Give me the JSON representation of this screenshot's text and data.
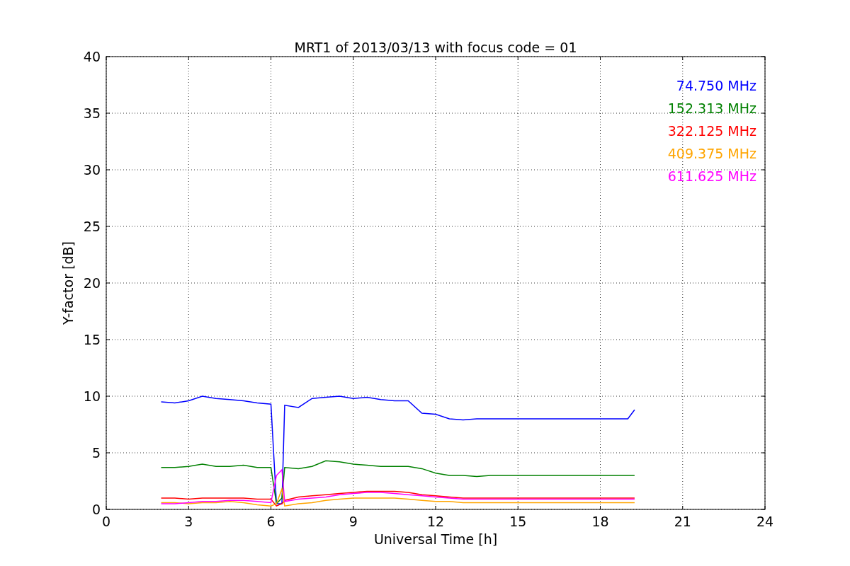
{
  "chart_data": {
    "type": "line",
    "title": "MRT1 of 2013/03/13 with focus code = 01",
    "xlabel": "Universal Time [h]",
    "ylabel": "Y-factor [dB]",
    "x": [
      2,
      2.5,
      3,
      3.5,
      4,
      4.5,
      5,
      5.5,
      6,
      6.2,
      6.4,
      6.5,
      7,
      7.5,
      8,
      8.5,
      9,
      9.5,
      10,
      10.5,
      11,
      11.5,
      12,
      12.5,
      13,
      13.5,
      14,
      19,
      19.25
    ],
    "series": [
      {
        "name": "74.750 MHz",
        "color": "#0000ff",
        "values": [
          9.5,
          9.4,
          9.6,
          10,
          9.8,
          9.7,
          9.6,
          9.4,
          9.3,
          0.5,
          0.5,
          9.2,
          9.0,
          9.8,
          9.9,
          10,
          9.8,
          9.9,
          9.7,
          9.6,
          9.6,
          8.5,
          8.4,
          8.0,
          7.9,
          8.0,
          8.0,
          8.0,
          8.8
        ]
      },
      {
        "name": "152.313 MHz",
        "color": "#008000",
        "values": [
          3.7,
          3.7,
          3.8,
          4.0,
          3.8,
          3.8,
          3.9,
          3.7,
          3.7,
          0.5,
          1.0,
          3.7,
          3.6,
          3.8,
          4.3,
          4.2,
          4.0,
          3.9,
          3.8,
          3.8,
          3.8,
          3.6,
          3.2,
          3.0,
          3.0,
          2.9,
          3.0,
          3.0,
          3.0
        ]
      },
      {
        "name": "322.125 MHz",
        "color": "#ff0000",
        "values": [
          1.0,
          1.0,
          0.9,
          1.0,
          1.0,
          1.0,
          1.0,
          0.9,
          0.9,
          0.3,
          0.5,
          0.8,
          1.1,
          1.2,
          1.3,
          1.4,
          1.5,
          1.6,
          1.6,
          1.6,
          1.5,
          1.3,
          1.2,
          1.1,
          1.0,
          1.0,
          1.0,
          1.0,
          1.0
        ]
      },
      {
        "name": "409.375 MHz",
        "color": "#ffa500",
        "values": [
          0.6,
          0.6,
          0.5,
          0.6,
          0.6,
          0.7,
          0.6,
          0.4,
          0.3,
          0.5,
          1.8,
          0.3,
          0.5,
          0.6,
          0.8,
          0.9,
          1.0,
          1.0,
          1.0,
          1.0,
          0.9,
          0.8,
          0.7,
          0.7,
          0.6,
          0.6,
          0.6,
          0.6,
          0.6
        ]
      },
      {
        "name": "611.625 MHz",
        "color": "#ff00ff",
        "values": [
          0.5,
          0.5,
          0.6,
          0.7,
          0.7,
          0.8,
          0.8,
          0.7,
          0.6,
          3.0,
          3.5,
          0.7,
          0.9,
          1.0,
          1.1,
          1.3,
          1.4,
          1.5,
          1.5,
          1.4,
          1.3,
          1.2,
          1.1,
          1.0,
          0.9,
          0.9,
          0.9,
          0.9,
          0.9
        ]
      }
    ],
    "grid": true,
    "xlim": [
      0,
      24
    ],
    "ylim": [
      0,
      40
    ],
    "xticks": [
      0,
      3,
      6,
      9,
      12,
      15,
      18,
      21,
      24
    ],
    "yticks": [
      0,
      5,
      10,
      15,
      20,
      25,
      30,
      35,
      40
    ]
  }
}
